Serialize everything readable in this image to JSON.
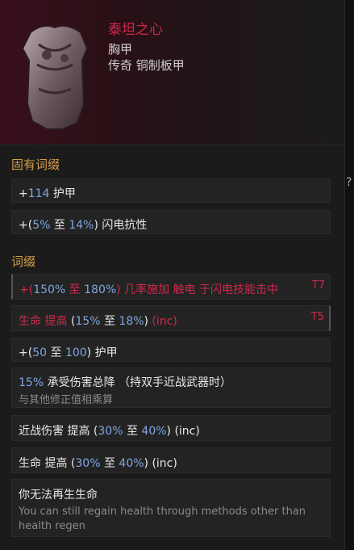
{
  "item": {
    "name": "泰坦之心",
    "slot": "胸甲",
    "rarity_type": "传奇 铜制板甲"
  },
  "sections": {
    "implicit_title": "固有词缀",
    "affix_title": "词缀"
  },
  "implicit": [
    {
      "prefix": "+",
      "num": "114",
      "text": " 护甲"
    },
    {
      "prefix": "+(",
      "num1": "5%",
      "mid": " 至 ",
      "num2": "14%",
      "text": ") 闪电抗性"
    }
  ],
  "affixes": {
    "a1": {
      "prefix": "+(",
      "num1": "150%",
      "mid": " 至 ",
      "num2": "180%",
      "text": ") 几率施加 触电 于闪电技能击中",
      "tier": "T7"
    },
    "a2": {
      "text1": "生命 提高",
      "open": " (",
      "num1": "15%",
      "mid": " 至 ",
      "num2": "18%",
      "close": ")",
      "suffix": " (inc)",
      "tier": "T5"
    },
    "a3": {
      "prefix": "+(",
      "num1": "50",
      "mid": " 至 ",
      "num2": "100",
      "text": ") 护甲"
    },
    "a4": {
      "num": "15%",
      "text": " 承受伤害总降 （持双手近战武器时）",
      "note": "与其他修正值相乘算"
    },
    "a5": {
      "text1": "近战伤害 提高",
      "open": " (",
      "num1": "30%",
      "mid": " 至 ",
      "num2": "40%",
      "close": ")",
      "suffix": " (inc)"
    },
    "a6": {
      "text1": "生命 提高",
      "open": " (",
      "num1": "30%",
      "mid": " 至 ",
      "num2": "40%",
      "close": ")",
      "suffix": " (inc)"
    },
    "a7": {
      "text": "你无法再生生命",
      "note1": "You can still regain health through methods other than",
      "note2": "health regen"
    }
  },
  "side": {
    "q": "?"
  },
  "colors": {
    "name": "#d0284c",
    "number": "#7ea6e0",
    "section": "#d6a04a"
  }
}
